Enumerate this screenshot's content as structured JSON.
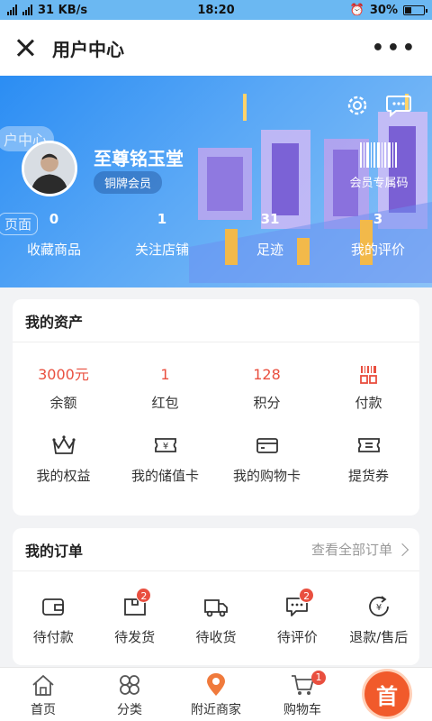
{
  "statusbar": {
    "network": "31 KB/s",
    "time": "18:20",
    "battery": "30%",
    "battery_level": 0.3
  },
  "titlebar": {
    "title": "用户中心",
    "more": "•••"
  },
  "profile": {
    "name": "至尊铭玉堂",
    "badge": "铜牌会员",
    "vip_code_label": "会员专属码",
    "ghost_text_1": "户中心",
    "ghost_text_2": "页面",
    "stats": [
      {
        "value": "0",
        "label": "收藏商品"
      },
      {
        "value": "1",
        "label": "关注店铺"
      },
      {
        "value": "31",
        "label": "足迹"
      },
      {
        "value": "3",
        "label": "我的评价"
      }
    ]
  },
  "assets": {
    "title": "我的资产",
    "top": [
      {
        "value": "3000元",
        "label": "余额"
      },
      {
        "value": "1",
        "label": "红包"
      },
      {
        "value": "128",
        "label": "积分"
      },
      {
        "icon": "barcode-pay-icon",
        "label": "付款"
      }
    ],
    "bottom": [
      {
        "icon": "crown-icon",
        "label": "我的权益"
      },
      {
        "icon": "yen-card-icon",
        "label": "我的储值卡"
      },
      {
        "icon": "shopping-card-icon",
        "label": "我的购物卡"
      },
      {
        "icon": "voucher-icon",
        "label": "提货券"
      }
    ]
  },
  "orders": {
    "title": "我的订单",
    "view_all": "查看全部订单",
    "items": [
      {
        "icon": "wallet-icon",
        "label": "待付款",
        "badge": ""
      },
      {
        "icon": "package-icon",
        "label": "待发货",
        "badge": "2"
      },
      {
        "icon": "truck-icon",
        "label": "待收货",
        "badge": ""
      },
      {
        "icon": "comment-icon",
        "label": "待评价",
        "badge": "2"
      },
      {
        "icon": "refund-icon",
        "label": "退款/售后",
        "badge": ""
      }
    ]
  },
  "bottomnav": {
    "items": [
      {
        "icon": "home-icon",
        "label": "首页"
      },
      {
        "icon": "category-icon",
        "label": "分类"
      },
      {
        "icon": "location-icon",
        "label": "附近商家"
      },
      {
        "icon": "cart-icon",
        "label": "购物车",
        "badge": "1"
      }
    ],
    "home_button": "首"
  },
  "colors": {
    "accent": "#e94f3f",
    "hero_start": "#2b8df3",
    "hero_end": "#8cc3f7",
    "home_button": "#f15a2b"
  }
}
